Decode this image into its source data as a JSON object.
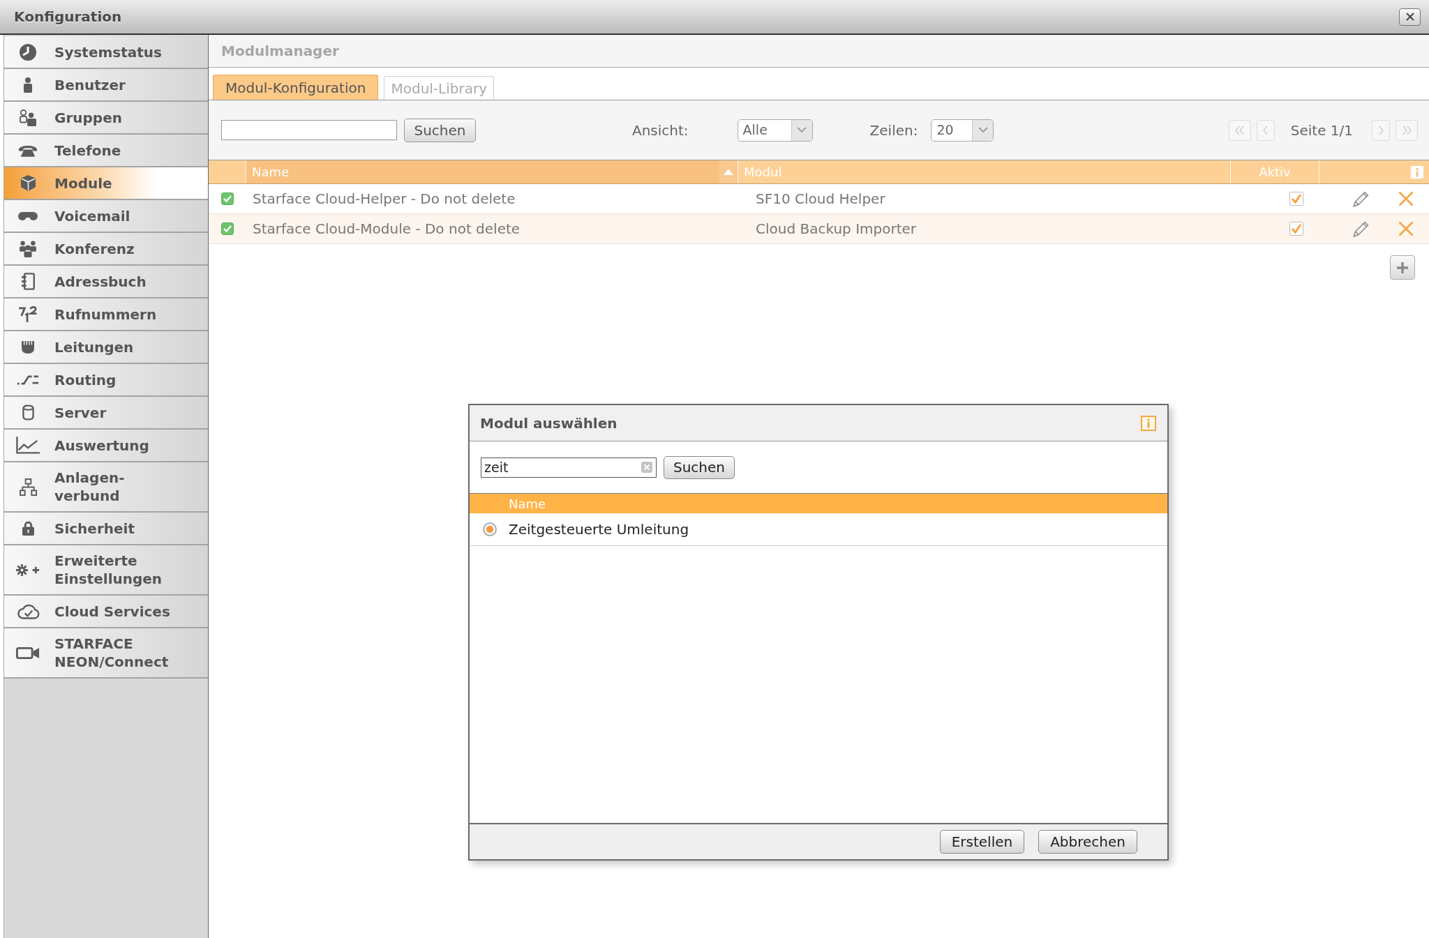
{
  "window": {
    "title": "Konfiguration"
  },
  "sidebar": {
    "items": [
      {
        "label": "Systemstatus",
        "selected": false
      },
      {
        "label": "Benutzer",
        "selected": false
      },
      {
        "label": "Gruppen",
        "selected": false
      },
      {
        "label": "Telefone",
        "selected": false
      },
      {
        "label": "Module",
        "selected": true
      },
      {
        "label": "Voicemail",
        "selected": false
      },
      {
        "label": "Konferenz",
        "selected": false
      },
      {
        "label": "Adressbuch",
        "selected": false
      },
      {
        "label": "Rufnummern",
        "selected": false
      },
      {
        "label": "Leitungen",
        "selected": false
      },
      {
        "label": "Routing",
        "selected": false
      },
      {
        "label": "Server",
        "selected": false
      },
      {
        "label": "Auswertung",
        "selected": false
      },
      {
        "label": "Anlagen-\nverbund",
        "selected": false
      },
      {
        "label": "Sicherheit",
        "selected": false
      },
      {
        "label": "Erweiterte\nEinstellungen",
        "selected": false
      },
      {
        "label": "Cloud Services",
        "selected": false
      },
      {
        "label": "STARFACE\nNEON/Connect",
        "selected": false
      }
    ]
  },
  "panel": {
    "title": "Modulmanager"
  },
  "tabs": [
    {
      "label": "Modul-Konfiguration",
      "selected": true
    },
    {
      "label": "Modul-Library",
      "selected": false
    }
  ],
  "toolbar": {
    "search_button": "Suchen",
    "view": {
      "label": "Ansicht:",
      "value": "Alle"
    },
    "rows_per_page": {
      "label": "Zeilen:",
      "value": "20"
    },
    "pager": {
      "first": {
        "disabled": true
      },
      "previous": {
        "disabled": true
      },
      "page": "Seite 1/1",
      "next": {
        "disabled": true
      },
      "last": {
        "disabled": true
      }
    }
  },
  "table": {
    "columns": [
      {
        "label": "Name",
        "sorted": true
      },
      {
        "label": "Modul",
        "sorted": false
      },
      {
        "label": "Aktiv",
        "sorted": false
      }
    ],
    "rows": [
      {
        "checked": true,
        "name": "Starface Cloud-Helper - Do not delete",
        "module": "SF10 Cloud Helper",
        "active": true
      },
      {
        "checked": true,
        "name": "Starface Cloud-Module - Do not delete",
        "module": "Cloud Backup Importer",
        "active": true
      }
    ]
  },
  "dialog": {
    "title": "Modul auswählen",
    "search": {
      "value": "zeit"
    },
    "search_button": "Suchen",
    "column": "Name",
    "options": [
      {
        "label": "Zeitgesteuerte Umleitung",
        "selected": true
      }
    ],
    "buttons": [
      "Erstellen",
      "Abbrechen"
    ]
  }
}
